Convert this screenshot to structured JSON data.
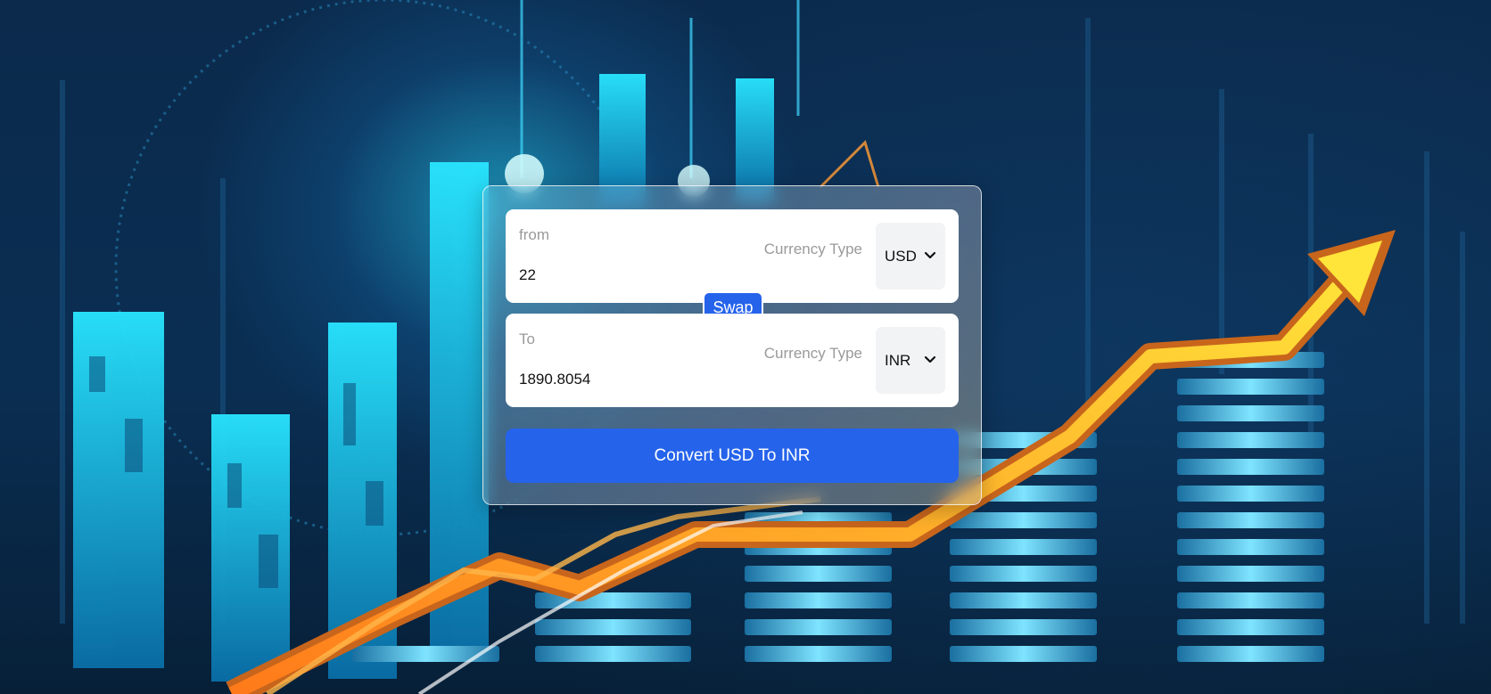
{
  "converter": {
    "from": {
      "label": "from",
      "amount": "22",
      "currency_type_label": "Currency Type",
      "currency": "USD"
    },
    "swap_label": "Swap",
    "to": {
      "label": "To",
      "amount": "1890.8054",
      "currency_type_label": "Currency Type",
      "currency": "INR"
    },
    "convert_label": "Convert USD To INR"
  },
  "colors": {
    "accent": "#2563eb",
    "panel": "#ffffff",
    "select_bg": "#f2f3f5",
    "label": "#9a9a9a"
  },
  "icons": {
    "select_chevron": "chevron-down-icon"
  }
}
